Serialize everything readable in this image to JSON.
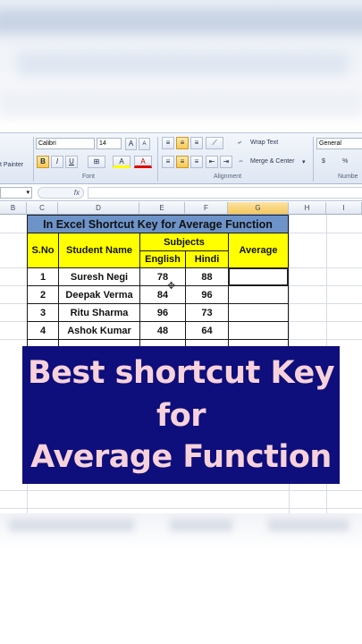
{
  "ribbon": {
    "clipboard": {
      "format_painter": "t Painter"
    },
    "font": {
      "name": "Calibri",
      "size": "14",
      "grow": "A",
      "shrink": "A",
      "bold": "B",
      "italic": "I",
      "underline": "U",
      "borders": "⊞",
      "fill": "A",
      "color": "A",
      "label": "Font"
    },
    "alignment": {
      "wrap_text": "Wrap Text",
      "merge_center": "Merge & Center",
      "label": "Alignment"
    },
    "number": {
      "format": "General",
      "currency": "$",
      "percent": "%",
      "label": "Numbe"
    }
  },
  "formula_bar": {
    "fx": "fx",
    "value": ""
  },
  "columns": [
    "B",
    "C",
    "D",
    "E",
    "F",
    "G",
    "H",
    "I"
  ],
  "selected_column": "G",
  "table": {
    "title": "In Excel Shortcut Key for Average Function",
    "headers": {
      "sno": "S.No",
      "name": "Student Name",
      "subjects": "Subjects",
      "english": "English",
      "hindi": "Hindi",
      "average": "Average"
    },
    "rows": [
      {
        "sno": "1",
        "name": "Suresh Negi",
        "english": "78",
        "hindi": "88",
        "average": ""
      },
      {
        "sno": "2",
        "name": "Deepak Verma",
        "english": "84",
        "hindi": "96",
        "average": ""
      },
      {
        "sno": "3",
        "name": "Ritu Sharma",
        "english": "96",
        "hindi": "73",
        "average": ""
      },
      {
        "sno": "4",
        "name": "Ashok Kumar",
        "english": "48",
        "hindi": "64",
        "average": ""
      }
    ]
  },
  "overlay": {
    "line1": "Best shortcut Key",
    "line2": "for",
    "line3": "Average Function"
  },
  "colors": {
    "title_fill": "#6d93c9",
    "header_fill": "#ffff00",
    "banner_fill": "#0e0e7c",
    "banner_text": "#f7d2da"
  }
}
